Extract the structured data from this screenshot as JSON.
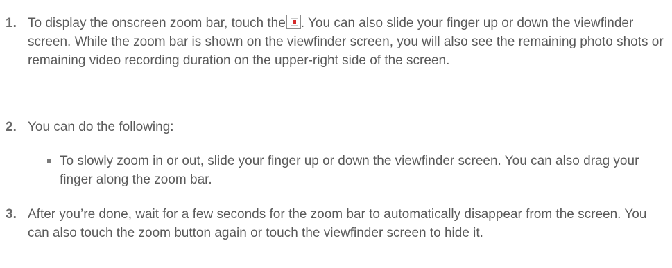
{
  "steps": [
    {
      "number": "1.",
      "text_before_icon": "To display the onscreen zoom bar, touch the",
      "icon": "broken-image-icon",
      "text_after_icon": ". You can also slide your finger up or down the viewfinder screen. While the zoom bar is shown on the viewfinder screen, you will also see the remaining photo shots or remaining video recording duration on the upper-right side of the screen."
    },
    {
      "number": "2.",
      "text": "You can do the following:",
      "bullets": [
        "To slowly zoom in or out, slide your finger up or down the viewfinder screen. You can also drag your finger along the zoom bar."
      ]
    },
    {
      "number": "3.",
      "text": "After you’re done, wait for a few seconds for the zoom bar to automatically disappear from the screen. You can also touch the zoom button again or touch the viewfinder screen to hide it."
    }
  ]
}
